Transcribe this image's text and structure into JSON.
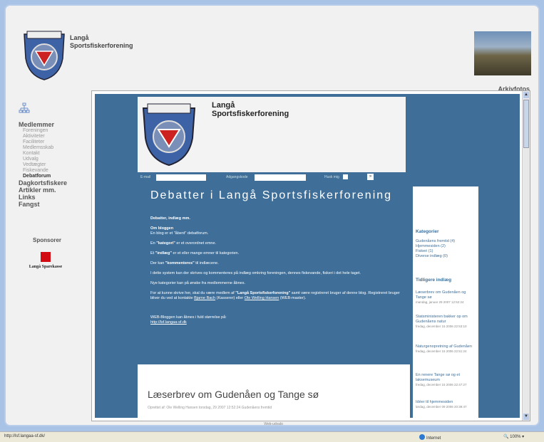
{
  "site": {
    "name_line1": "Langå",
    "name_line2": "Sportsfiskerforening",
    "arkiv_label": "Arkivfotos"
  },
  "nav": {
    "items": [
      {
        "label": "Medlemmer",
        "type": "main"
      },
      {
        "label": "Foreningen",
        "type": "sub"
      },
      {
        "label": "Aktiviteter",
        "type": "sub"
      },
      {
        "label": "Faciliteter",
        "type": "sub"
      },
      {
        "label": "Medlemsskab",
        "type": "sub"
      },
      {
        "label": "Kontakt",
        "type": "sub"
      },
      {
        "label": "Udvalg",
        "type": "sub"
      },
      {
        "label": "Vedtægter",
        "type": "sub"
      },
      {
        "label": "Fiskevande",
        "type": "sub"
      },
      {
        "label": "Debatforum",
        "type": "sub-active"
      },
      {
        "label": "Dagkortsfiskere",
        "type": "main"
      },
      {
        "label": "Artikler mm.",
        "type": "main"
      },
      {
        "label": "Links",
        "type": "main"
      },
      {
        "label": "Fangst",
        "type": "main"
      }
    ],
    "sponsor_label": "Sponsorer",
    "sponsor_name": "Langå Sparekasse"
  },
  "blog": {
    "header_line1": "Langå",
    "header_line2": "Sportsfiskerforening",
    "login": {
      "email_label": "E-mail",
      "password_label": "Adgangskode",
      "remember_label": "Husk mig",
      "go_label": "»"
    },
    "title": "Debatter i Langå Sportsfiskerforening",
    "intro_heading": "Debatter, indlæg mm.",
    "about_heading": "Om bloggen",
    "p1": "En blog er et \"åbent\" debatforum.",
    "p2_pre": "En ",
    "p2_bold": "\"kategori\"",
    "p2_post": " er et overordnet emne.",
    "p3_pre": "Et ",
    "p3_bold": "\"indlæg\"",
    "p3_post": " er et eller mange emner til kategorien.",
    "p4_pre": "Der kan ",
    "p4_bold": "\"kommenteres\"",
    "p4_post": " til indlæcene.",
    "p5": "I dette system kan der skrives og kommenteres på indlæg omkring foreningen, dennes fiskevande, fiskeri i det hele taget.",
    "p6": "Nye kategorier kan på ønske fra medlemmerne åbnes.",
    "p7_pre": "For at kunne skrive her, skal du være medlem af ",
    "p7_bold": "\"Langå Sportsfiskerforening\"",
    "p7_mid": " samt være registreret bruger af denne blog. Registreret bruger bliver du ved at kontakte ",
    "p7_link1": "Bjarne Bach",
    "p7_mid2": " (Kasserer) eller ",
    "p7_link2": "Ole Welling Hansen",
    "p7_post": " (WEB-master).",
    "p8": "WEB-Bloggen kan åbnes i fuld størrelse på:",
    "p8_link": "http://lsf.langaa-sf.dk",
    "post_title": "Læserbrev om Gudenåen og Tange sø",
    "post_meta": "Oprettet af: Ole Welling Hansen   torsdag, 29 2007 12:52:24          Gudenåens fremtid"
  },
  "sidebar": {
    "categories_heading": "Kategorier",
    "categories": [
      "Gudenåens fremtid (4)",
      "Hjemmesiden (2)",
      "Fiskeri (1)",
      "Diverse indlæg (0)"
    ],
    "earlier_heading": "Tidligere indlæg",
    "entries": [
      {
        "title": "Læserbrev om Gudenåen og Tange sø",
        "date": "mandag, januar 29 2007 12:52:24"
      },
      {
        "title": "Statsministeren bakker op om Gudenåens natur",
        "date": "fredag, december 15 2006 22:53:10"
      },
      {
        "title": "Naturgenopretning af Gudenåen",
        "date": "fredag, december 15 2006 22:51:24"
      },
      {
        "title": "En renere Tange sø og et laksemuseum",
        "date": "fredag, december 15 2006 22:47:27"
      },
      {
        "title": "Idéer til hjemmesiden",
        "date": "lørdag, december 09 2006 20:39:47"
      }
    ]
  },
  "browser": {
    "footer_text": "Web-udvalg",
    "status_url": "http://lsf.langaa-sf.dk/",
    "zone": "Internet",
    "zoom": "100%"
  }
}
